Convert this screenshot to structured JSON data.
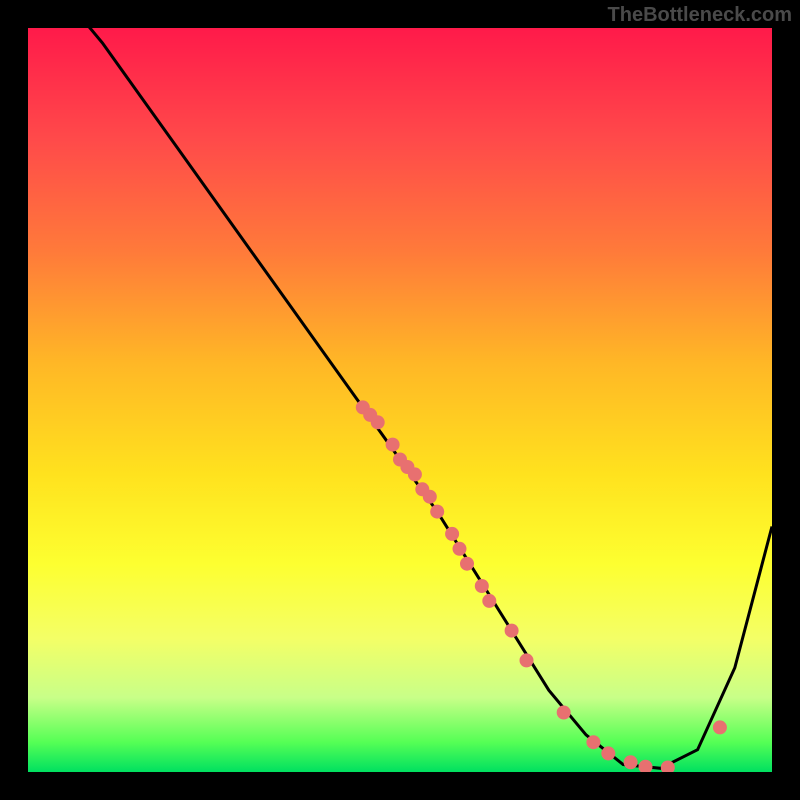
{
  "watermark": "TheBottleneck.com",
  "chart_data": {
    "type": "line",
    "title": "",
    "xlabel": "",
    "ylabel": "",
    "xlim": [
      0,
      100
    ],
    "ylim": [
      0,
      100
    ],
    "series": [
      {
        "name": "curve",
        "x": [
          0,
          5,
          10,
          15,
          20,
          25,
          30,
          35,
          40,
          45,
          50,
          55,
          60,
          65,
          70,
          75,
          80,
          85,
          90,
          95,
          100
        ],
        "y": [
          110,
          104,
          98,
          91,
          84,
          77,
          70,
          63,
          56,
          49,
          42,
          35,
          27,
          19,
          11,
          5,
          1,
          0.5,
          3,
          14,
          33
        ]
      }
    ],
    "markers": {
      "name": "data-points",
      "color": "#e87070",
      "x": [
        45,
        46,
        47,
        49,
        50,
        51,
        52,
        53,
        54,
        55,
        57,
        58,
        59,
        61,
        62,
        65,
        67,
        72,
        76,
        78,
        81,
        83,
        86,
        93
      ],
      "y": [
        49,
        48,
        47,
        44,
        42,
        41,
        40,
        38,
        37,
        35,
        32,
        30,
        28,
        25,
        23,
        19,
        15,
        8,
        4,
        2.5,
        1.3,
        0.7,
        0.6,
        6
      ]
    },
    "background_gradient": {
      "top": "#ff1a4a",
      "upper_mid": "#ffb726",
      "lower_mid": "#fdff30",
      "bottom": "#00e060"
    }
  }
}
